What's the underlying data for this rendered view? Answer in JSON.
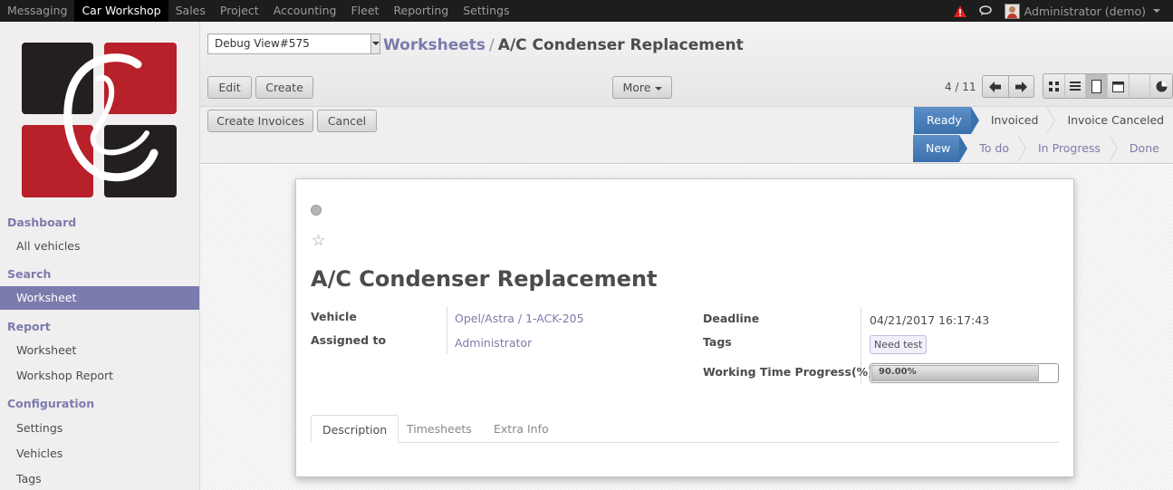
{
  "topbar": {
    "apps": [
      "Messaging",
      "Car Workshop",
      "Sales",
      "Project",
      "Accounting",
      "Fleet",
      "Reporting",
      "Settings"
    ],
    "active_app": "Car Workshop",
    "user": "Administrator (demo)"
  },
  "sidebar": {
    "sections": [
      {
        "title": "Dashboard",
        "items": [
          "All vehicles"
        ]
      },
      {
        "title": "Search",
        "items": [
          "Worksheet"
        ]
      },
      {
        "title": "Report",
        "items": [
          "Worksheet",
          "Workshop Report"
        ]
      },
      {
        "title": "Configuration",
        "items": [
          "Settings",
          "Vehicles",
          "Tags"
        ]
      }
    ],
    "active_item": "Worksheet"
  },
  "control": {
    "debug_select": "Debug View#575",
    "breadcrumb_parent": "Worksheets",
    "breadcrumb_sep": "/",
    "breadcrumb_current": "A/C Condenser Replacement",
    "edit_label": "Edit",
    "create_label": "Create",
    "more_label": "More",
    "pager": "4 / 11",
    "create_invoices_label": "Create Invoices",
    "cancel_label": "Cancel"
  },
  "status_top": [
    "Ready",
    "Invoiced",
    "Invoice Canceled"
  ],
  "status_bottom": [
    "New",
    "To do",
    "In Progress",
    "Done"
  ],
  "form": {
    "title": "A/C Condenser Replacement",
    "vehicle_label": "Vehicle",
    "vehicle_value": "Opel/Astra / 1-ACK-205",
    "assigned_label": "Assigned to",
    "assigned_value": "Administrator",
    "deadline_label": "Deadline",
    "deadline_value": "04/21/2017 16:17:43",
    "tags_label": "Tags",
    "tag_value": "Need test",
    "progress_label": "Working Time Progress(%)",
    "progress_text": "90.00%",
    "progress_value": 0.9,
    "tabs": [
      "Description",
      "Timesheets",
      "Extra Info"
    ]
  },
  "colors": {
    "accent": "#7c7bad",
    "status_active": "#3a70ad",
    "topbar": "#1d1d1d"
  }
}
